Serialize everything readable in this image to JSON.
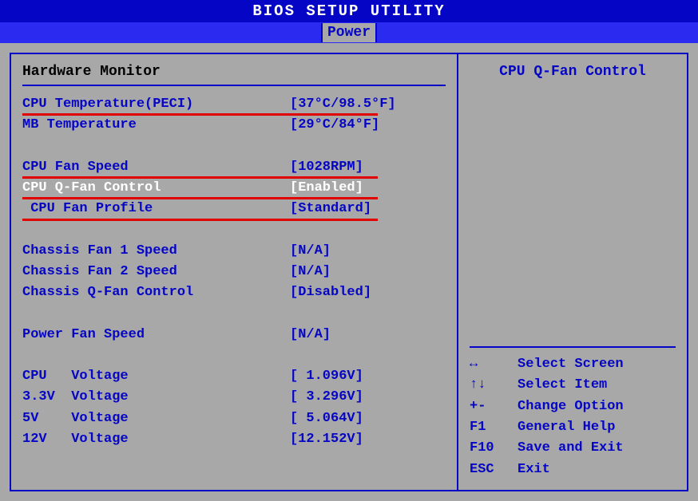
{
  "header": {
    "title": "BIOS SETUP UTILITY",
    "active_tab": "Power"
  },
  "main": {
    "title": "Hardware Monitor",
    "rows": [
      {
        "label": "CPU Temperature(PECI)",
        "value": "[37°C/98.5°F]",
        "underline": true,
        "uwidth": 445,
        "interactable": true
      },
      {
        "label": "MB Temperature",
        "value": "[29°C/84°F]",
        "underline": false,
        "interactable": true
      },
      {
        "spacer": true
      },
      {
        "label": "CPU Fan Speed",
        "value": "[1028RPM]",
        "underline": true,
        "uwidth": 445,
        "interactable": true
      },
      {
        "label": "CPU Q-Fan Control",
        "value": "[Enabled]",
        "underline": true,
        "uwidth": 445,
        "selected": true,
        "interactable": true
      },
      {
        "label": " CPU Fan Profile",
        "value": "[Standard]",
        "underline": true,
        "uwidth": 445,
        "interactable": true
      },
      {
        "spacer": true
      },
      {
        "label": "Chassis Fan 1 Speed",
        "value": "[N/A]",
        "interactable": true
      },
      {
        "label": "Chassis Fan 2 Speed",
        "value": "[N/A]",
        "interactable": true
      },
      {
        "label": "Chassis Q-Fan Control",
        "value": "[Disabled]",
        "interactable": true
      },
      {
        "spacer": true
      },
      {
        "label": "Power Fan Speed",
        "value": "[N/A]",
        "interactable": true
      },
      {
        "spacer": true
      },
      {
        "label": "CPU   Voltage",
        "value": "[ 1.096V]",
        "interactable": true
      },
      {
        "label": "3.3V  Voltage",
        "value": "[ 3.296V]",
        "interactable": true
      },
      {
        "label": "5V    Voltage",
        "value": "[ 5.064V]",
        "interactable": true
      },
      {
        "label": "12V   Voltage",
        "value": "[12.152V]",
        "interactable": true
      }
    ]
  },
  "help": {
    "title": "CPU Q-Fan Control",
    "keys": [
      {
        "key": "↔",
        "desc": "Select Screen"
      },
      {
        "key": "↑↓",
        "desc": "Select Item"
      },
      {
        "key": "+-",
        "desc": "Change Option"
      },
      {
        "key": "F1",
        "desc": "General Help"
      },
      {
        "key": "F10",
        "desc": "Save and Exit"
      },
      {
        "key": "ESC",
        "desc": "Exit"
      }
    ]
  }
}
